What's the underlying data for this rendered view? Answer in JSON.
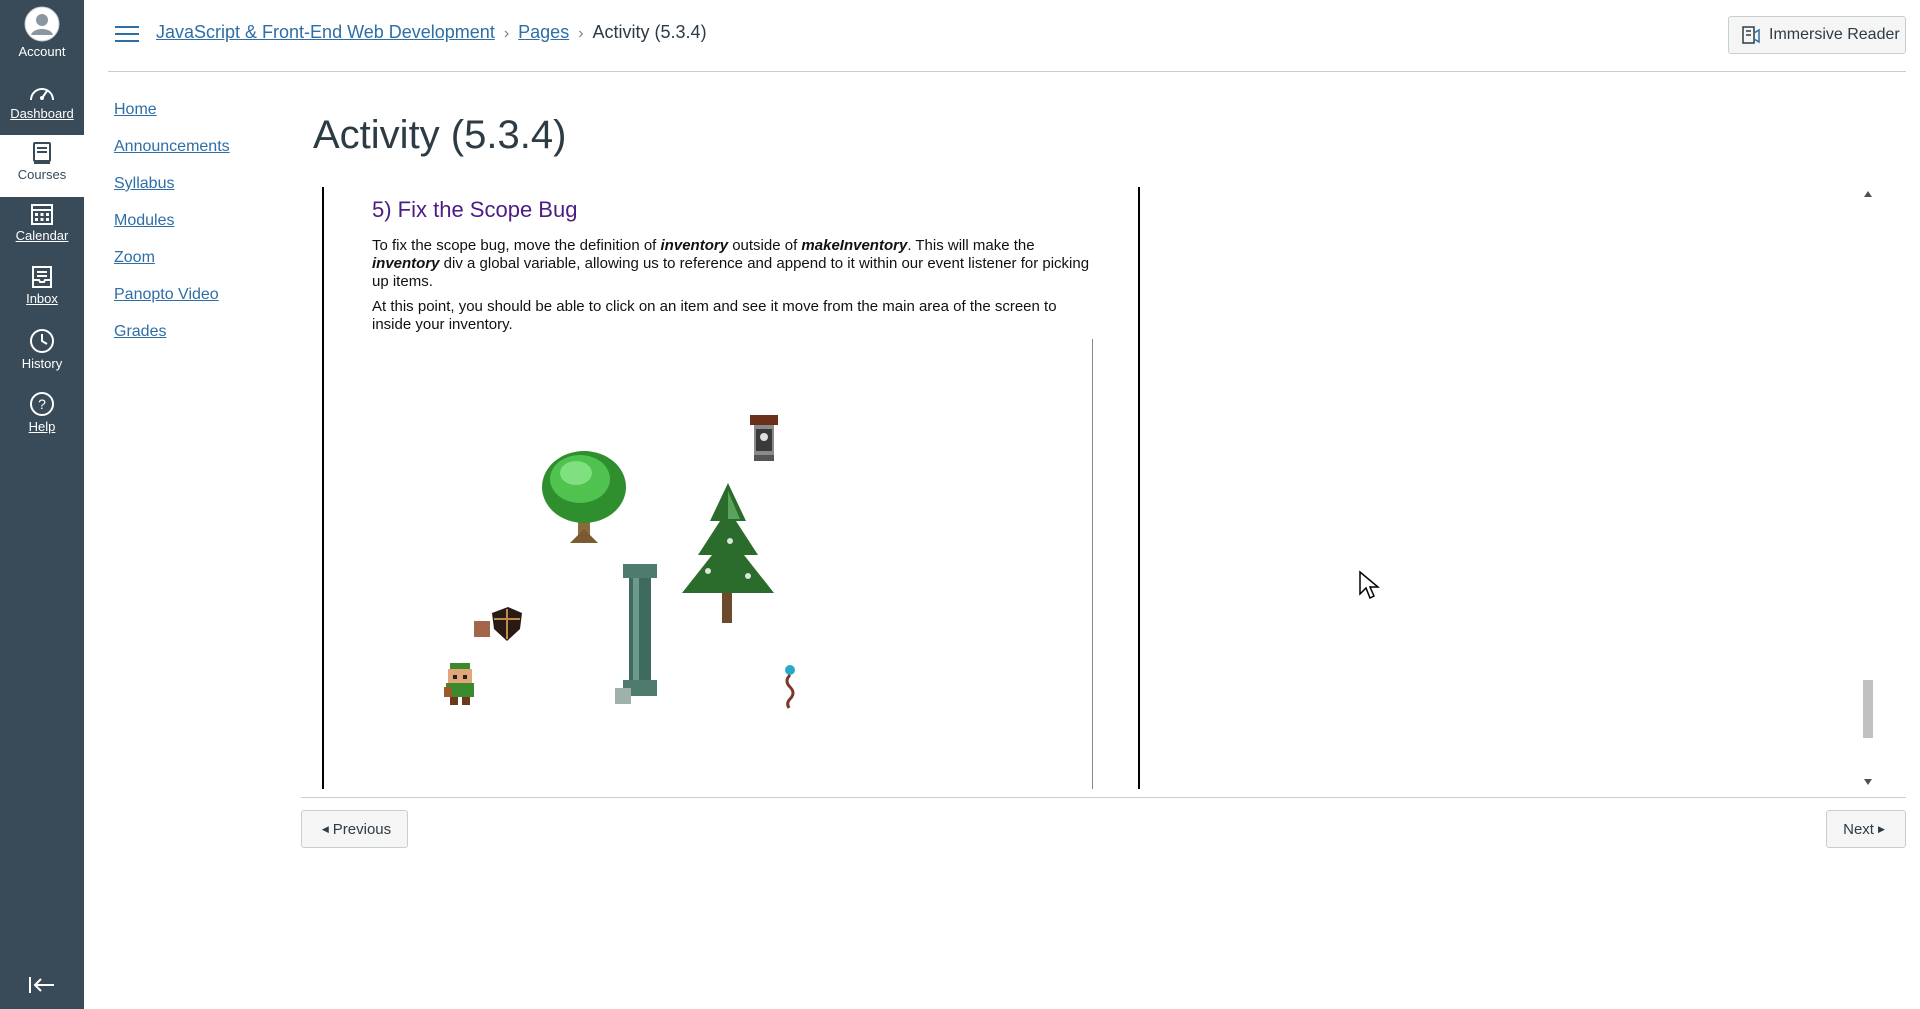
{
  "global_nav": {
    "items": [
      {
        "label": "Account",
        "icon": "account-icon"
      },
      {
        "label": "Dashboard",
        "icon": "dashboard-icon"
      },
      {
        "label": "Courses",
        "icon": "courses-icon"
      },
      {
        "label": "Calendar",
        "icon": "calendar-icon"
      },
      {
        "label": "Inbox",
        "icon": "inbox-icon"
      },
      {
        "label": "History",
        "icon": "history-icon"
      },
      {
        "label": "Help",
        "icon": "help-icon"
      }
    ],
    "colors": {
      "background": "#394b58",
      "active_background": "#ffffff"
    }
  },
  "header": {
    "breadcrumbs": [
      {
        "label": "JavaScript & Front-End Web Development"
      },
      {
        "label": "Pages"
      },
      {
        "label": "Activity (5.3.4)"
      }
    ],
    "immersive_reader_label": "Immersive Reader"
  },
  "course_nav": {
    "items": [
      "Home",
      "Announcements",
      "Syllabus",
      "Modules",
      "Zoom",
      "Panopto Video",
      "Grades"
    ]
  },
  "page": {
    "title": "Activity (5.3.4)"
  },
  "content": {
    "heading": "5) Fix the Scope Bug",
    "p1_a": "To fix the scope bug, move the definition of ",
    "p1_b": "inventory",
    "p1_c": " outside of ",
    "p1_d": "makeInventory",
    "p1_e": ". This will make the ",
    "p1_f": "inventory",
    "p1_g": " div a global variable, allowing us to reference and append to it within our event listener for picking up items.",
    "p2": "At this point, you should be able to click on an item and see it move from the main area of the screen to inside your inventory.",
    "heading_color": "#4b1d87"
  },
  "footer": {
    "previous_label": "Previous",
    "next_label": "Next"
  }
}
